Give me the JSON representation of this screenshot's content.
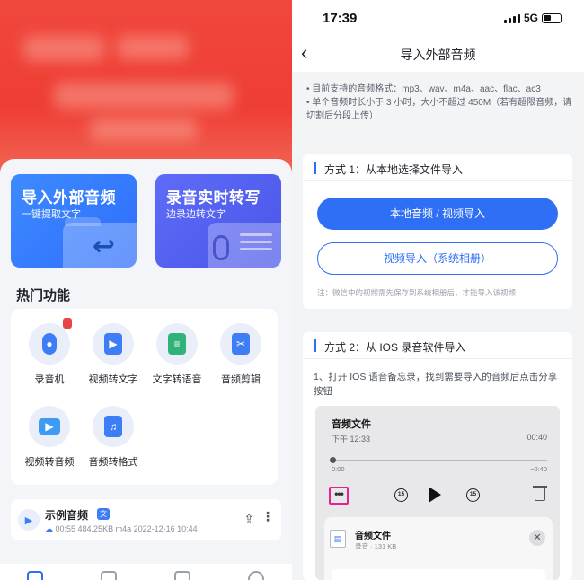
{
  "left": {
    "cards": [
      {
        "title": "导入外部音频",
        "subtitle": "一键提取文字"
      },
      {
        "title": "录音实时转写",
        "subtitle": "边录边转文字"
      }
    ],
    "section_title": "热门功能",
    "functions": [
      {
        "label": "录音机",
        "icon": "mic-icon",
        "color": "#3d7df6"
      },
      {
        "label": "视频转文字",
        "icon": "video-text-icon",
        "color": "#3d7df6"
      },
      {
        "label": "文字转语音",
        "icon": "text-speech-icon",
        "color": "#2fb37a"
      },
      {
        "label": "音频剪辑",
        "icon": "audio-cut-icon",
        "color": "#3d7df6"
      },
      {
        "label": "视频转音频",
        "icon": "video-audio-icon",
        "color": "#3d9bf6"
      },
      {
        "label": "音频转格式",
        "icon": "audio-format-icon",
        "color": "#3d7df6"
      }
    ],
    "sample": {
      "name": "示例音频",
      "tag": "文",
      "meta": "00:55  484.25KB  m4a  2022-12-16 10:44"
    }
  },
  "right": {
    "status": {
      "time": "17:39",
      "network": "5G"
    },
    "nav_title": "导入外部音频",
    "notes": [
      "• 目前支持的音频格式：mp3、wav、m4a、aac、flac、ac3",
      "• 单个音频时长小于 3 小时，大小不超过 450M（若有超限音频，请切割后分段上传）"
    ],
    "method1": {
      "heading": "方式 1：从本地选择文件导入",
      "primary_button": "本地音频 / 视频导入",
      "secondary_button": "视频导入（系统相册）",
      "note": "注：微信中的视频需先保存到系统相册后，才能导入该视频"
    },
    "method2": {
      "heading": "方式 2：从 IOS 录音软件导入",
      "step1": "1、打开 IOS 语音备忘录，找到需要导入的音频后点击分享按钮",
      "player": {
        "name": "音频文件",
        "time": "下午 12:33",
        "duration": "00:40",
        "start": "0:00",
        "end": "−0:40",
        "skip_back": "15",
        "skip_fwd": "15"
      },
      "share_sheet": {
        "file_name": "音频文件",
        "file_meta": "录音 · 131 KB"
      }
    }
  }
}
